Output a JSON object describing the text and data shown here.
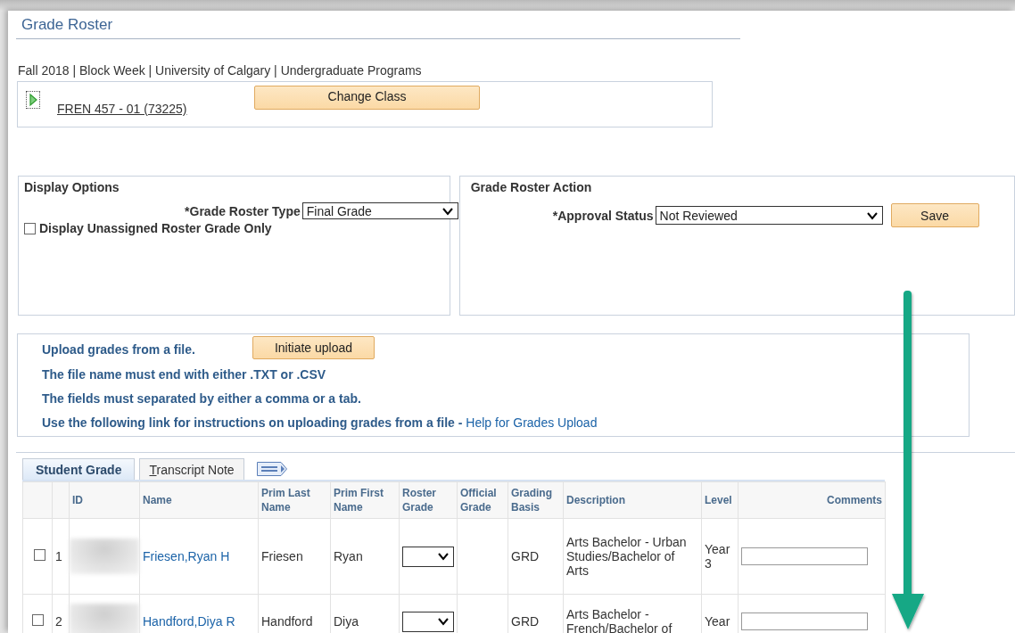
{
  "page_title": "Grade Roster",
  "term_line": "Fall 2018 | Block Week | University of Calgary | Undergraduate Programs",
  "class_selector": {
    "class_link": "FREN 457 - 01 (73225)",
    "button": "Change Class"
  },
  "display_options": {
    "title": "Display Options",
    "roster_type": {
      "label": "*Grade Roster Type",
      "value": "Final Grade"
    },
    "unassigned_only": {
      "label": "Display Unassigned Roster Grade Only",
      "checked": false
    }
  },
  "roster_action": {
    "title": "Grade Roster Action",
    "approval_status": {
      "label": "*Approval Status",
      "value": "Not Reviewed"
    },
    "button": "Save"
  },
  "upload": {
    "intro": "Upload grades from a file.",
    "button": "Initiate upload",
    "lines": [
      "The file name must end with either .TXT or .CSV",
      "The fields must separated by either a comma or a tab."
    ],
    "help_text": "Use the following link for instructions on uploading grades from a file -",
    "help_link": "Help for Grades Upload"
  },
  "grid": {
    "tabs": [
      {
        "label": "Student Grade",
        "selected": true,
        "mnemonic": false
      },
      {
        "label": "Transcript Note",
        "selected": false,
        "mnemonic": true
      }
    ],
    "columns": [
      "ID",
      "Name",
      "Prim Last Name",
      "Prim First Name",
      "Roster Grade",
      "Official Grade",
      "Grading Basis",
      "Description",
      "Level",
      "Comments"
    ],
    "rows": [
      {
        "checked": false,
        "number": "1",
        "name": "Friesen,Ryan H",
        "last_name": "Friesen",
        "first_name": "Ryan",
        "grading_basis": "GRD",
        "description": "Arts Bachelor - Urban Studies/Bachelor of Arts",
        "level": "Year 3"
      },
      {
        "checked": false,
        "number": "2",
        "name": "Handford,Diya R",
        "last_name": "Handford",
        "first_name": "Diya",
        "grading_basis": "GRD",
        "description": "Arts Bachelor - French/Bachelor of",
        "level": "Year"
      }
    ]
  }
}
